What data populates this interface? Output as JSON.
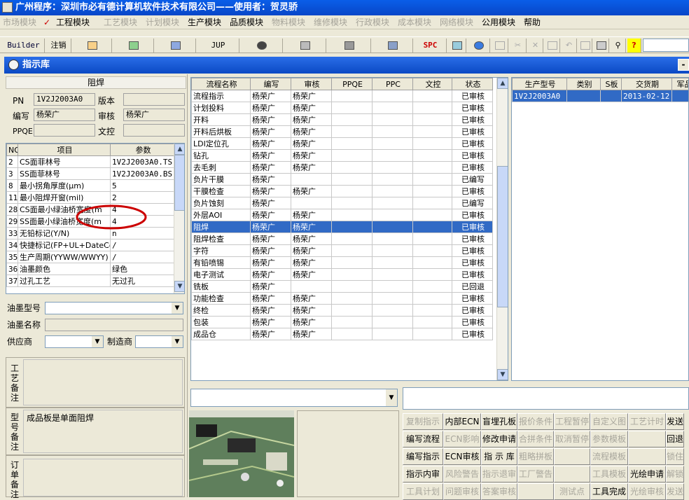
{
  "window": {
    "title": "广州程序：深圳市必有德计算机软件技术有限公司——使用者：贺灵骄"
  },
  "menu": [
    {
      "label": "市场模块",
      "enabled": false
    },
    {
      "label": "工程模块",
      "enabled": true,
      "checked": true
    },
    {
      "label": "工艺模块",
      "enabled": false
    },
    {
      "label": "计划模块",
      "enabled": false
    },
    {
      "label": "生产模块",
      "enabled": true
    },
    {
      "label": "品质模块",
      "enabled": true
    },
    {
      "label": "物料模块",
      "enabled": false
    },
    {
      "label": "维修模块",
      "enabled": false
    },
    {
      "label": "行政模块",
      "enabled": false
    },
    {
      "label": "成本模块",
      "enabled": false
    },
    {
      "label": "网络模块",
      "enabled": false
    },
    {
      "label": "公用模块",
      "enabled": true
    },
    {
      "label": "帮助",
      "enabled": true
    }
  ],
  "toolbar": {
    "builder": "Builder",
    "logout": "注销",
    "jup": "JUP",
    "spc": "SPC",
    "checkmark": "✓"
  },
  "panel": {
    "title": "指示库",
    "minimize": "-"
  },
  "left": {
    "section_title": "阻焊",
    "pn_label": "PN",
    "pn_value": "1V2J2003A0",
    "version_label": "版本",
    "version_value": "",
    "editor_label": "编写",
    "editor_value": "杨荣广",
    "reviewer_label": "审核",
    "reviewer_value": "杨荣广",
    "ppqe_label": "PPQE",
    "ppqe_value": "",
    "doc_label": "文控",
    "doc_value": "",
    "param_headers": [
      "NO",
      "项目",
      "参数"
    ],
    "params": [
      {
        "no": "2",
        "item": "CS面菲林号",
        "value": "1V2J2003A0.TS"
      },
      {
        "no": "3",
        "item": "SS面菲林号",
        "value": "1V2J2003A0.BS"
      },
      {
        "no": "8",
        "item": "最小拐角厚度(μm)",
        "value": "5"
      },
      {
        "no": "11",
        "item": "最小阻焊开窗(mil)",
        "value": "2"
      },
      {
        "no": "28",
        "item": "CS面最小绿油桥宽度(m",
        "value": "4"
      },
      {
        "no": "29",
        "item": "SS面最小绿油桥宽度(m",
        "value": "4"
      },
      {
        "no": "33",
        "item": "无铅标记(Y/N)",
        "value": "n"
      },
      {
        "no": "34",
        "item": "快捷标记(FP+UL+DateCo",
        "value": "/"
      },
      {
        "no": "35",
        "item": "生产周期(YYWW/WWYY)",
        "value": "/"
      },
      {
        "no": "36",
        "item": "油墨颜色",
        "value": "绿色"
      },
      {
        "no": "37",
        "item": "过孔工艺",
        "value": "无过孔"
      }
    ],
    "ink_model_label": "油墨型号",
    "ink_name_label": "油墨名称",
    "supplier_label": "供应商",
    "manufacturer_label": "制造商",
    "process_note_label": "工艺备注",
    "model_note_label": "型号备注",
    "model_note_value": "成品板是单面阻焊",
    "order_note_label": "订单备注",
    "annotation_color": "#cc0000"
  },
  "process": {
    "headers": [
      "流程名称",
      "编写",
      "审核",
      "PPQE",
      "PPC",
      "文控",
      "状态"
    ],
    "rows": [
      {
        "name": "流程指示",
        "editor": "杨荣广",
        "reviewer": "杨荣广",
        "status": "已审核"
      },
      {
        "name": "计划投料",
        "editor": "杨荣广",
        "reviewer": "杨荣广",
        "status": "已审核"
      },
      {
        "name": "开料",
        "editor": "杨荣广",
        "reviewer": "杨荣广",
        "status": "已审核"
      },
      {
        "name": "开料后烘板",
        "editor": "杨荣广",
        "reviewer": "杨荣广",
        "status": "已审核"
      },
      {
        "name": "LDI定位孔",
        "editor": "杨荣广",
        "reviewer": "杨荣广",
        "status": "已审核"
      },
      {
        "name": "钻孔",
        "editor": "杨荣广",
        "reviewer": "杨荣广",
        "status": "已审核"
      },
      {
        "name": "去毛刺",
        "editor": "杨荣广",
        "reviewer": "杨荣广",
        "status": "已审核"
      },
      {
        "name": "负片干膜",
        "editor": "杨荣广",
        "reviewer": "",
        "status": "已编写"
      },
      {
        "name": "干膜检查",
        "editor": "杨荣广",
        "reviewer": "杨荣广",
        "status": "已审核"
      },
      {
        "name": "负片蚀刻",
        "editor": "杨荣广",
        "reviewer": "",
        "status": "已编写"
      },
      {
        "name": "外层AOI",
        "editor": "杨荣广",
        "reviewer": "杨荣广",
        "status": "已审核"
      },
      {
        "name": "阻焊",
        "editor": "杨荣广",
        "reviewer": "杨荣广",
        "status": "已审核",
        "selected": true
      },
      {
        "name": "阻焊检查",
        "editor": "杨荣广",
        "reviewer": "杨荣广",
        "status": "已审核"
      },
      {
        "name": "字符",
        "editor": "杨荣广",
        "reviewer": "杨荣广",
        "status": "已审核"
      },
      {
        "name": "有铅喷锡",
        "editor": "杨荣广",
        "reviewer": "杨荣广",
        "status": "已审核"
      },
      {
        "name": "电子测试",
        "editor": "杨荣广",
        "reviewer": "杨荣广",
        "status": "已审核"
      },
      {
        "name": "铣板",
        "editor": "杨荣广",
        "reviewer": "",
        "status": "已回退"
      },
      {
        "name": "功能检查",
        "editor": "杨荣广",
        "reviewer": "杨荣广",
        "status": "已审核"
      },
      {
        "name": "终检",
        "editor": "杨荣广",
        "reviewer": "杨荣广",
        "status": "已审核"
      },
      {
        "name": "包装",
        "editor": "杨荣广",
        "reviewer": "杨荣广",
        "status": "已审核"
      },
      {
        "name": "成品仓",
        "editor": "杨荣广",
        "reviewer": "杨荣广",
        "status": "已审核"
      }
    ]
  },
  "orders": {
    "headers": [
      "生产型号",
      "类别",
      "S板",
      "交货期",
      "军品"
    ],
    "rows": [
      {
        "model": "1V2J2003A0",
        "type": "",
        "s": "",
        "date": "2013-02-12",
        "mil": ""
      }
    ]
  },
  "buttons": [
    [
      {
        "label": "复制指示",
        "enabled": false
      },
      {
        "label": "内部ECN",
        "enabled": true
      },
      {
        "label": "盲埋孔板",
        "enabled": true
      },
      {
        "label": "报价条件",
        "enabled": false
      },
      {
        "label": "工程暂停",
        "enabled": false
      },
      {
        "label": "自定义图",
        "enabled": false
      },
      {
        "label": "工艺计时",
        "enabled": false
      },
      {
        "label": "发送",
        "enabled": true
      }
    ],
    [
      {
        "label": "编写流程",
        "enabled": true
      },
      {
        "label": "ECN影响",
        "enabled": false
      },
      {
        "label": "修改申请",
        "enabled": true
      },
      {
        "label": "合拼条件",
        "enabled": false
      },
      {
        "label": "取消暂停",
        "enabled": false
      },
      {
        "label": "参数模板",
        "enabled": false
      },
      {
        "label": "",
        "enabled": false
      },
      {
        "label": "回退",
        "enabled": true
      }
    ],
    [
      {
        "label": "编写指示",
        "enabled": true
      },
      {
        "label": "ECN审核",
        "enabled": true
      },
      {
        "label": "指 示 库",
        "enabled": true
      },
      {
        "label": "粗略拼板",
        "enabled": false
      },
      {
        "label": "",
        "enabled": false
      },
      {
        "label": "流程模板",
        "enabled": false
      },
      {
        "label": "",
        "enabled": false
      },
      {
        "label": "锁住",
        "enabled": false
      }
    ],
    [
      {
        "label": "指示内审",
        "enabled": true
      },
      {
        "label": "风险警告",
        "enabled": false
      },
      {
        "label": "指示退审",
        "enabled": false
      },
      {
        "label": "工厂警告",
        "enabled": false
      },
      {
        "label": "",
        "enabled": false
      },
      {
        "label": "工具模板",
        "enabled": false
      },
      {
        "label": "光绘申请",
        "enabled": true
      },
      {
        "label": "解锁",
        "enabled": false
      }
    ],
    [
      {
        "label": "工具计划",
        "enabled": false
      },
      {
        "label": "问题审核",
        "enabled": false
      },
      {
        "label": "答案审核",
        "enabled": false
      },
      {
        "label": "",
        "enabled": false
      },
      {
        "label": "测试点",
        "enabled": false
      },
      {
        "label": "工具完成",
        "enabled": true
      },
      {
        "label": "光绘审核",
        "enabled": false
      },
      {
        "label": "发送",
        "enabled": false
      }
    ]
  ]
}
